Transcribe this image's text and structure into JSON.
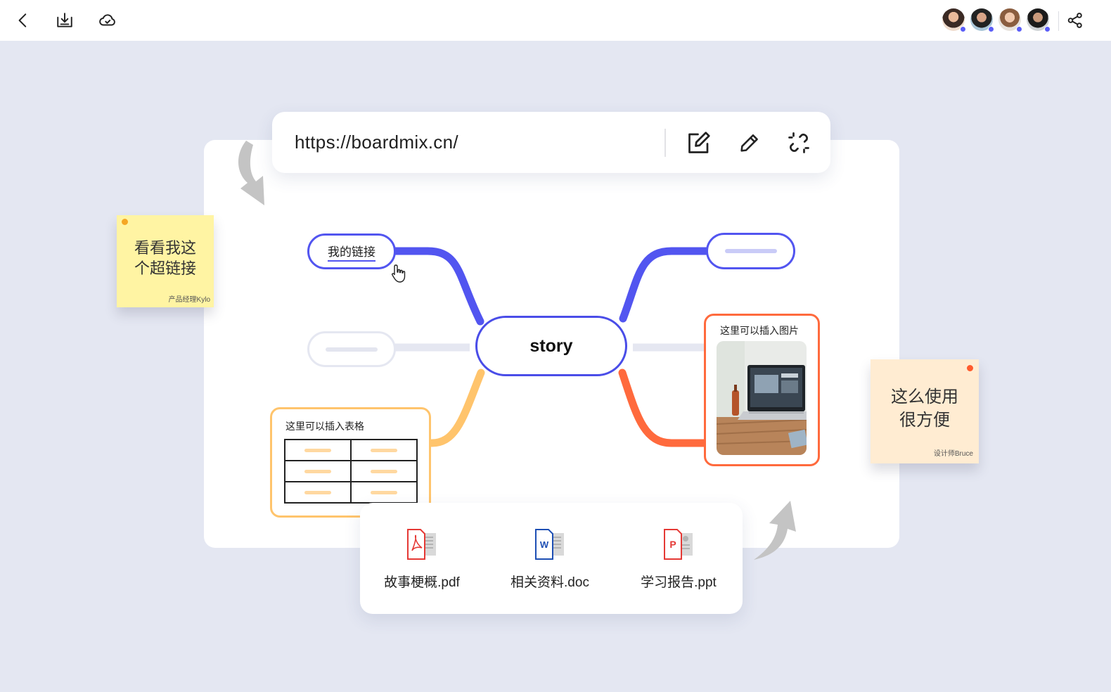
{
  "topbar": {
    "icons": [
      "back-icon",
      "download-icon",
      "cloud-icon",
      "share-icon"
    ],
    "avatars": [
      {
        "name": "collaborator-1"
      },
      {
        "name": "collaborator-2"
      },
      {
        "name": "collaborator-3"
      },
      {
        "name": "collaborator-4"
      }
    ]
  },
  "link_bar": {
    "url": "https://boardmix.cn/",
    "icons": [
      "edit-link-icon",
      "pen-icon",
      "unlink-icon"
    ]
  },
  "mindmap": {
    "center": "story",
    "link_node": "我的链接",
    "table_card": {
      "title": "这里可以插入表格",
      "rows": 3,
      "cols": 2
    },
    "image_card": {
      "title": "这里可以插入图片"
    },
    "colors": {
      "blue": "#5255f0",
      "orange": "#ff6a3d",
      "yellow": "#ffc46c",
      "gray": "#e5e7f1"
    }
  },
  "notes": {
    "yellow": {
      "text_line1": "看看我这",
      "text_line2": "个超链接",
      "author": "产品经理Kylo",
      "pin_color": "#f5a623"
    },
    "peach": {
      "text_line1": "这么使用",
      "text_line2": "很方便",
      "author": "设计师Bruce",
      "pin_color": "#ff5a2c"
    }
  },
  "files": [
    {
      "name": "故事梗概.pdf",
      "type": "pdf",
      "color": "#e53935"
    },
    {
      "name": "相关资料.doc",
      "type": "doc",
      "color": "#1e4fb4"
    },
    {
      "name": "学习报告.ppt",
      "type": "ppt",
      "color": "#e53935"
    }
  ]
}
